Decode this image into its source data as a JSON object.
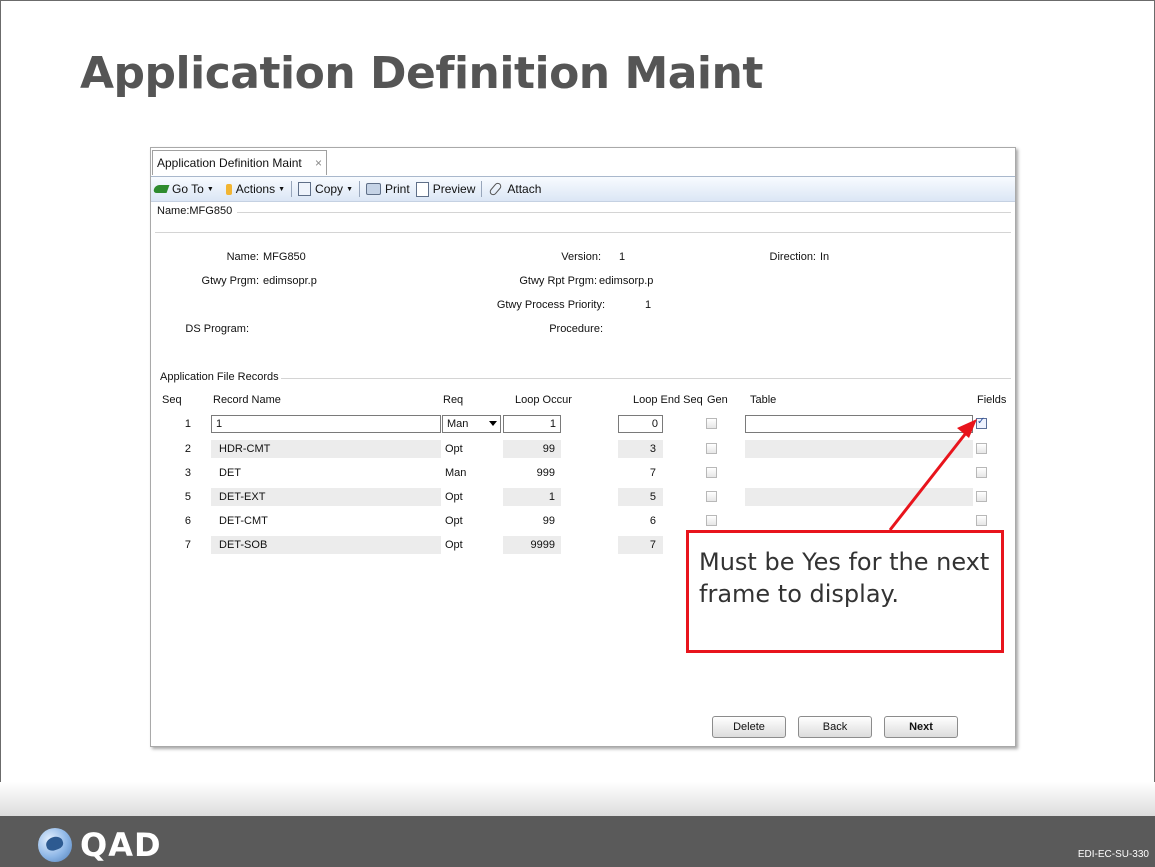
{
  "slide": {
    "title": "Application Definition Maint",
    "logo_text": "QAD",
    "doc_code": "EDI-EC-SU-330"
  },
  "window": {
    "tab_label": "Application Definition Maint",
    "tab_close": "×"
  },
  "toolbar": {
    "goto": "Go To",
    "actions": "Actions",
    "copy": "Copy",
    "print": "Print",
    "preview": "Preview",
    "attach": "Attach"
  },
  "name_bar": "Name:MFG850",
  "header": {
    "name_label": "Name:",
    "name_value": "MFG850",
    "version_label": "Version:",
    "version_value": "1",
    "direction_label": "Direction:",
    "direction_value": "In",
    "gtwy_prgm_label": "Gtwy Prgm:",
    "gtwy_prgm_value": "edimsopr.p",
    "gtwy_rpt_prgm_label": "Gtwy Rpt Prgm:",
    "gtwy_rpt_prgm_value": "edimsorp.p",
    "gtwy_priority_label": "Gtwy Process Priority:",
    "gtwy_priority_value": "1",
    "ds_program_label": "DS Program:",
    "procedure_label": "Procedure:"
  },
  "records": {
    "section_label": "Application File Records",
    "columns": {
      "seq": "Seq",
      "record_name": "Record Name",
      "req": "Req",
      "loop_occur": "Loop Occur",
      "loop_end_seq": "Loop End Seq",
      "gen": "Gen",
      "table": "Table",
      "fields": "Fields"
    },
    "rows": [
      {
        "seq": "1",
        "record_name": "1",
        "req": "Man",
        "loop_occur": "1",
        "loop_end": "0",
        "gen": false,
        "table": "",
        "fields": true
      },
      {
        "seq": "2",
        "record_name": "HDR-CMT",
        "req": "Opt",
        "loop_occur": "99",
        "loop_end": "3",
        "gen": false,
        "table": "",
        "fields": false
      },
      {
        "seq": "3",
        "record_name": "DET",
        "req": "Man",
        "loop_occur": "999",
        "loop_end": "7",
        "gen": false,
        "table": "",
        "fields": false
      },
      {
        "seq": "5",
        "record_name": "DET-EXT",
        "req": "Opt",
        "loop_occur": "1",
        "loop_end": "5",
        "gen": false,
        "table": "",
        "fields": false
      },
      {
        "seq": "6",
        "record_name": "DET-CMT",
        "req": "Opt",
        "loop_occur": "99",
        "loop_end": "6",
        "gen": false,
        "table": "",
        "fields": false
      },
      {
        "seq": "7",
        "record_name": "DET-SOB",
        "req": "Opt",
        "loop_occur": "9999",
        "loop_end": "7",
        "gen": false,
        "table": "",
        "fields": false
      }
    ]
  },
  "buttons": {
    "delete": "Delete",
    "back": "Back",
    "next": "Next"
  },
  "callout": {
    "text": "Must be Yes for the next frame to display.",
    "border_color": "#e8141c"
  }
}
